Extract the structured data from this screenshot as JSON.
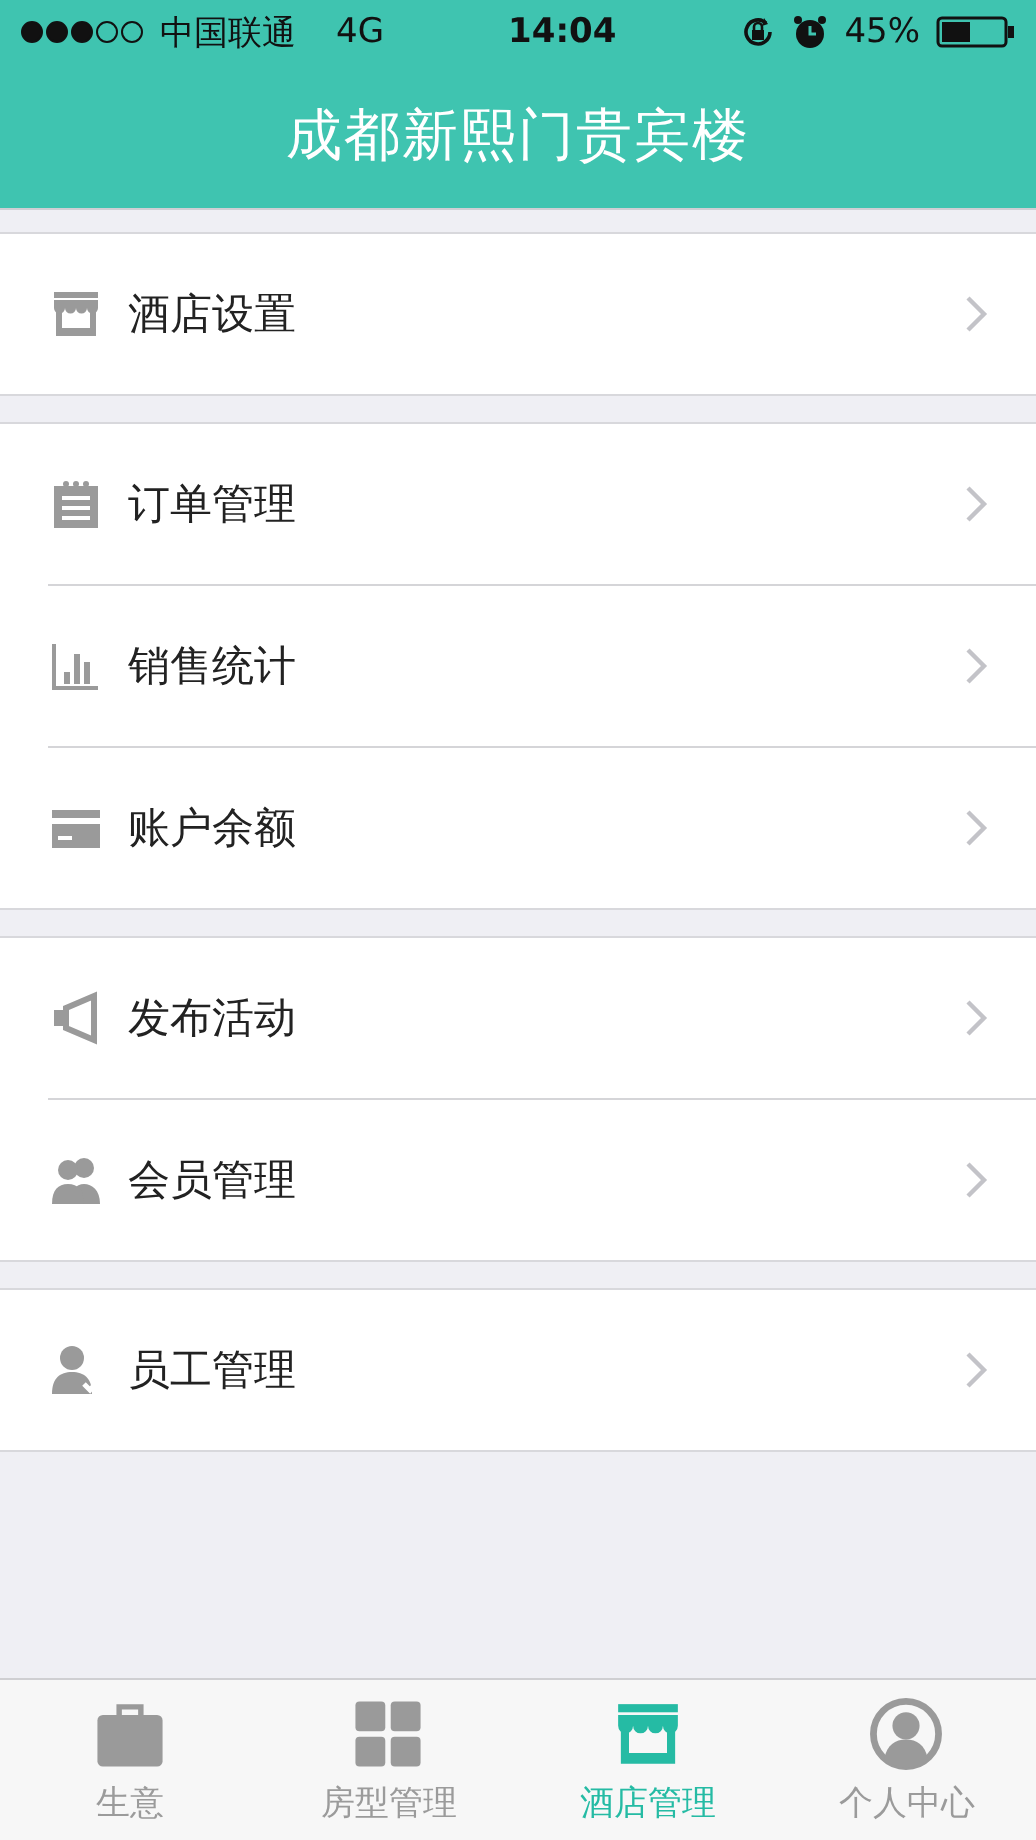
{
  "status_bar": {
    "carrier": "中国联通",
    "network": "4G",
    "time": "14:04",
    "battery": "45%"
  },
  "header": {
    "title": "成都新熙门贵宾楼"
  },
  "groups": [
    {
      "items": [
        {
          "label": "酒店设置",
          "kind": "store"
        }
      ]
    },
    {
      "items": [
        {
          "label": "订单管理",
          "kind": "notepad"
        },
        {
          "label": "销售统计",
          "kind": "chart"
        },
        {
          "label": "账户余额",
          "kind": "card"
        }
      ]
    },
    {
      "items": [
        {
          "label": "发布活动",
          "kind": "megaphone"
        },
        {
          "label": "会员管理",
          "kind": "people"
        }
      ]
    },
    {
      "items": [
        {
          "label": "员工管理",
          "kind": "staff"
        }
      ]
    }
  ],
  "tab_bar": [
    {
      "label": "生意",
      "kind": "briefcase",
      "selected": false
    },
    {
      "label": "房型管理",
      "kind": "grid",
      "selected": false
    },
    {
      "label": "酒店管理",
      "kind": "store",
      "selected": true
    },
    {
      "label": "个人中心",
      "kind": "person",
      "selected": false
    }
  ]
}
